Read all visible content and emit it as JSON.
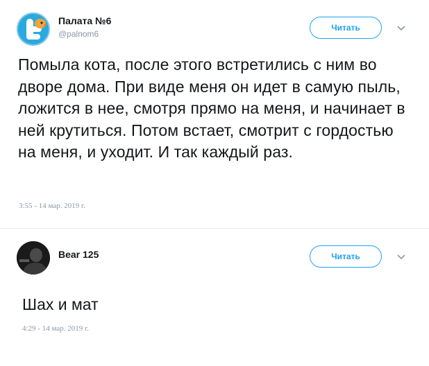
{
  "tweets": [
    {
      "author_name": "Палата №6",
      "author_handle": "@palnom6",
      "follow_label": "Читать",
      "text": "Помыла кота, после этого встретились с ним во дворе дома. При виде меня он идет в самую пыль, ложится в нее, смотря прямо на меня, и начинает в ней крутиться. Потом встает, смотрит с гордостью на меня, и уходит. И так каждый раз.",
      "timestamp": "3:55 - 14 мар. 2019 г.",
      "avatar_icon": "twitter-bird-avatar"
    },
    {
      "author_name": "Bear 125",
      "follow_label": "Читать",
      "text": "Шах и мат",
      "timestamp": "4:29 - 14 мар. 2019 г.",
      "avatar_icon": "dark-photo-avatar"
    }
  ],
  "colors": {
    "accent": "#1da1f2",
    "text": "#14171a",
    "secondary": "#8a98a6",
    "divider": "#e6ecf0"
  }
}
